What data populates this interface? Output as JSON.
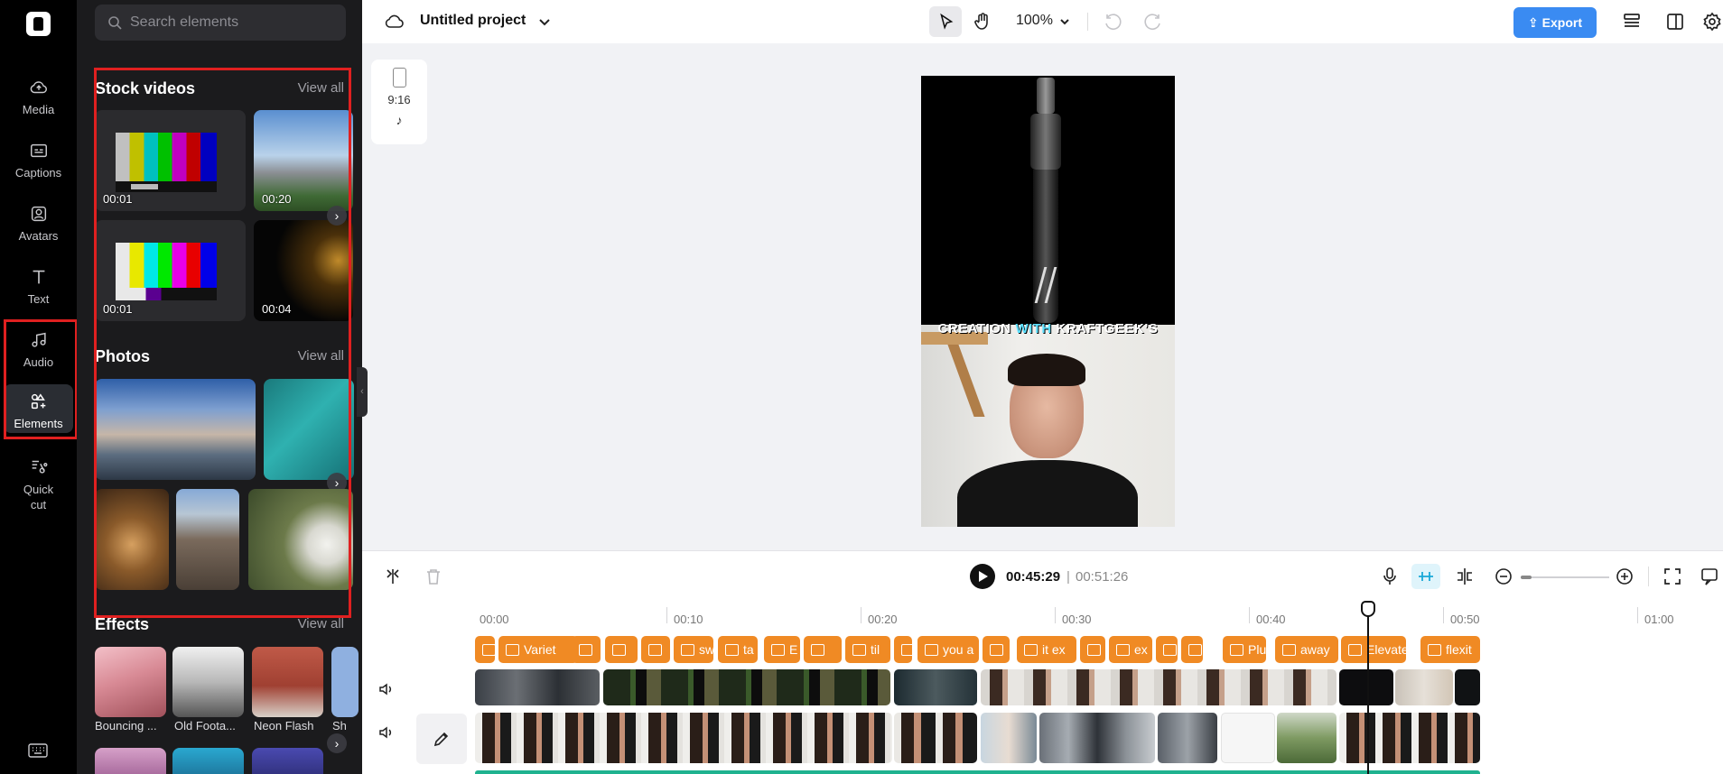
{
  "rail": {
    "items": [
      {
        "label": "Media",
        "icon": "cloud-upload-icon"
      },
      {
        "label": "Captions",
        "icon": "captions-icon"
      },
      {
        "label": "Avatars",
        "icon": "avatar-icon"
      },
      {
        "label": "Text",
        "icon": "text-icon"
      },
      {
        "label": "Audio",
        "icon": "music-note-icon"
      },
      {
        "label": "Elements",
        "icon": "shapes-icon"
      },
      {
        "label": "Quick cut",
        "icon": "quick-cut-icon"
      }
    ],
    "active": "Elements"
  },
  "panel": {
    "search_placeholder": "Search elements",
    "stock_videos": {
      "title": "Stock videos",
      "view_all": "View all",
      "items": [
        {
          "duration": "00:01",
          "kind": "color-bars"
        },
        {
          "duration": "00:20",
          "kind": "mountains"
        },
        {
          "duration": "00:01",
          "kind": "color-bars"
        },
        {
          "duration": "00:04",
          "kind": "sparkles"
        }
      ]
    },
    "photos": {
      "title": "Photos",
      "view_all": "View all"
    },
    "effects": {
      "title": "Effects",
      "view_all": "View all",
      "items": [
        "Bouncing ...",
        "Old Foota...",
        "Neon Flash",
        "Sh"
      ]
    }
  },
  "topbar": {
    "project_title": "Untitled project",
    "zoom": "100%",
    "export_label": "Export"
  },
  "canvas": {
    "ratio_label": "9:16",
    "caption_prefix": "CREATION ",
    "caption_highlight": "WITH",
    "caption_suffix": " KRAFTGEEK’S"
  },
  "timeline": {
    "current_time": "00:45:29",
    "separator": "|",
    "total_time": "00:51:26",
    "ruler": [
      "00:00",
      "00:10",
      "00:20",
      "00:30",
      "00:40",
      "00:50",
      "01:00"
    ],
    "caption_chips": [
      "",
      "Variet",
      "",
      "",
      "",
      "sw",
      "ta",
      "E",
      "",
      "til",
      "",
      "you a",
      "",
      "it ex",
      "",
      "ex",
      "",
      "",
      "Plu",
      "away",
      "Elevate",
      "flexit"
    ]
  },
  "colors": {
    "accent": "#3a8bf2",
    "caption_chip": "#f08a24",
    "highlight_box": "#e02020",
    "panel_bg": "#1b1b1d"
  }
}
